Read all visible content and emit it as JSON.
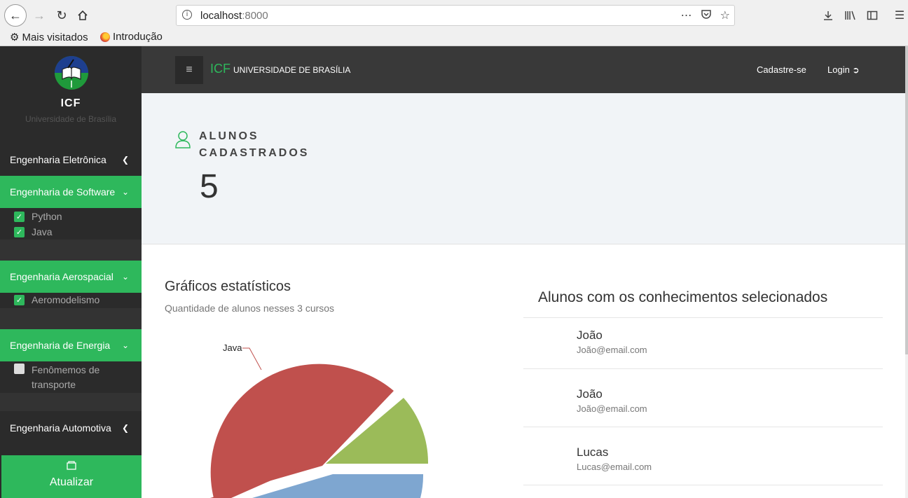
{
  "browser": {
    "url_host": "localhost",
    "url_port": ":8000",
    "bookmarks": [
      {
        "label": "Mais visitados"
      },
      {
        "label": "Introdução"
      }
    ]
  },
  "sidebar": {
    "brand_title": "ICF",
    "brand_subtitle": "Universidade de Brasília",
    "menus": [
      {
        "label": "Engenharia Eletrônica",
        "expanded": false
      },
      {
        "label": "Engenharia de Software",
        "expanded": true,
        "items": [
          {
            "label": "Python",
            "checked": true
          },
          {
            "label": "Java",
            "checked": true
          }
        ]
      },
      {
        "label": "Engenharia Aerospacial",
        "expanded": true,
        "items": [
          {
            "label": "Aeromodelismo",
            "checked": true
          }
        ]
      },
      {
        "label": "Engenharia de Energia",
        "expanded": true,
        "items": [
          {
            "label": "Fenômemos de transporte",
            "checked": false
          }
        ]
      },
      {
        "label": "Engenharia Automotiva",
        "expanded": false
      }
    ],
    "refresh_label": "Atualizar"
  },
  "topbar": {
    "brand": "ICF",
    "brand_sub": "UNIVERSIDADE DE BRASÍLIA",
    "signup": "Cadastre-se",
    "login": "Login"
  },
  "stats": {
    "label": "ALUNOS CADASTRADOS",
    "value": "5"
  },
  "charts": {
    "title": "Gráficos estatísticos",
    "subtitle": "Quantidade de alunos nesses 3 cursos"
  },
  "chart_data": {
    "type": "pie",
    "labels": [
      "Java",
      "",
      ""
    ],
    "colors": [
      "#c0504d",
      "#9bbb59",
      "#7ea6d0"
    ],
    "note_visible_label": "Java"
  },
  "students": {
    "title": "Alunos com os conhecimentos selecionados",
    "items": [
      {
        "name": "João",
        "email": "João@email.com"
      },
      {
        "name": "João",
        "email": "João@email.com"
      },
      {
        "name": "Lucas",
        "email": "Lucas@email.com"
      }
    ]
  }
}
